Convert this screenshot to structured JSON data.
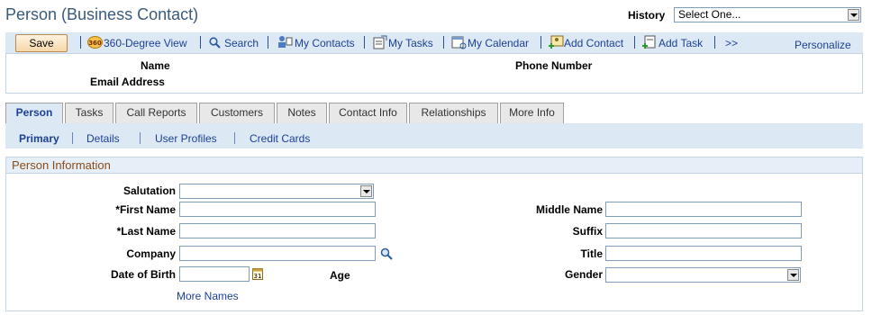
{
  "page": {
    "title": "Person (Business Contact)",
    "history_label": "History",
    "history_value": "Select One..."
  },
  "toolbar": {
    "save_label": "Save",
    "links": [
      {
        "label": "360-Degree View",
        "icon": "360-icon"
      },
      {
        "label": "Search",
        "icon": "search-icon"
      },
      {
        "label": "My Contacts",
        "icon": "contacts-icon"
      },
      {
        "label": "My Tasks",
        "icon": "tasks-icon"
      },
      {
        "label": "My Calendar",
        "icon": "calendar-icon"
      },
      {
        "label": "Add Contact",
        "icon": "add-contact-icon"
      },
      {
        "label": "Add Task",
        "icon": "add-task-icon"
      },
      {
        "label": ">>",
        "icon": ""
      }
    ],
    "personalize_label": "Personalize"
  },
  "header": {
    "name_label": "Name",
    "phone_label": "Phone Number",
    "email_label": "Email Address"
  },
  "tabs": [
    {
      "label": "Person",
      "active": true
    },
    {
      "label": "Tasks"
    },
    {
      "label": "Call Reports"
    },
    {
      "label": "Customers"
    },
    {
      "label": "Notes"
    },
    {
      "label": "Contact Info"
    },
    {
      "label": "Relationships"
    },
    {
      "label": "More Info"
    }
  ],
  "subnav": [
    {
      "label": "Primary",
      "active": true
    },
    {
      "label": "Details"
    },
    {
      "label": "User Profiles"
    },
    {
      "label": "Credit Cards"
    }
  ],
  "person_info": {
    "title": "Person Information",
    "salutation_label": "Salutation",
    "first_name_label": "*First Name",
    "last_name_label": "*Last Name",
    "company_label": "Company",
    "dob_label": "Date of Birth",
    "age_label": "Age",
    "middle_name_label": "Middle Name",
    "suffix_label": "Suffix",
    "title_label": "Title",
    "gender_label": "Gender",
    "more_names_label": "More Names"
  },
  "colors": {
    "link": "#1c3f94",
    "toolbar_bg": "#dce9f5",
    "group_title": "#8a4b18",
    "page_title": "#3a5a7c"
  }
}
